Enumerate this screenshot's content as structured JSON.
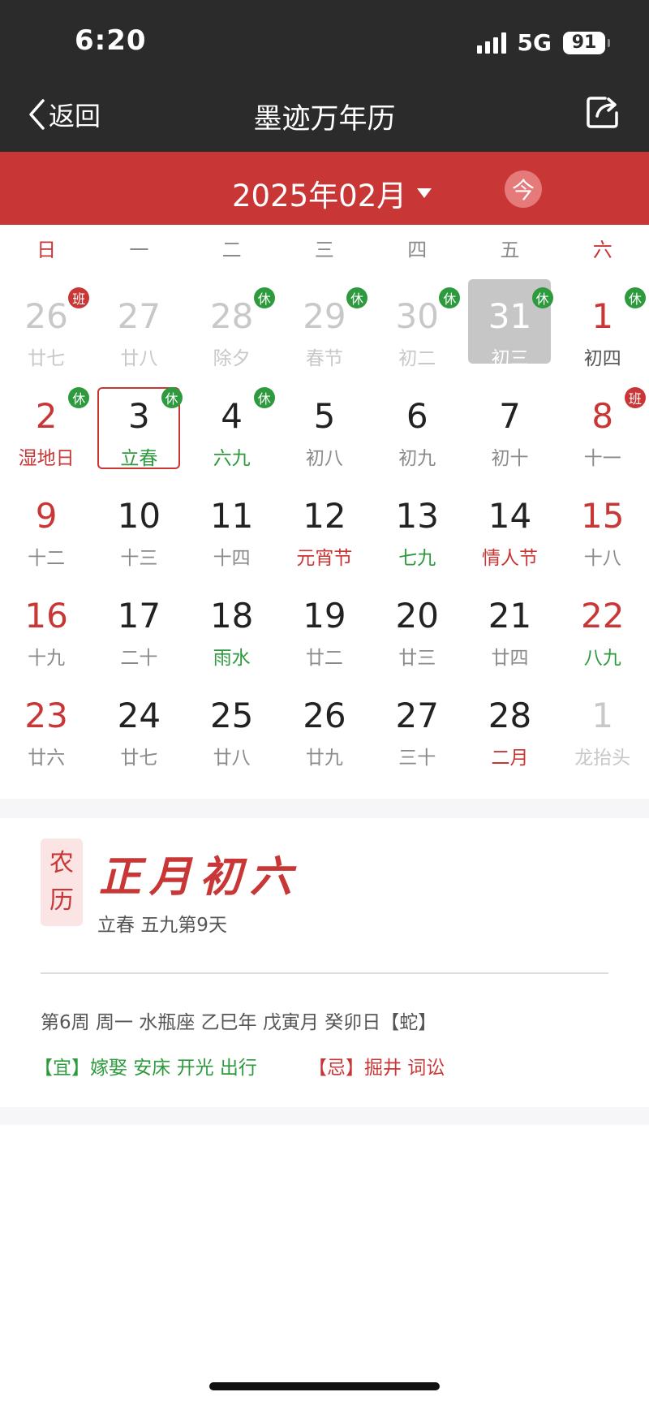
{
  "status": {
    "time": "6:20",
    "network": "5G",
    "battery": "91"
  },
  "nav": {
    "back_label": "返回",
    "title": "墨迹万年历"
  },
  "month_bar": {
    "month_label": "2025年02月",
    "today_label": "今"
  },
  "weekdays": [
    "日",
    "一",
    "二",
    "三",
    "四",
    "五",
    "六"
  ],
  "calendar": {
    "rows": [
      [
        {
          "day": "26",
          "sub": "廿七",
          "other": true,
          "badge": "班"
        },
        {
          "day": "27",
          "sub": "廿八",
          "other": true
        },
        {
          "day": "28",
          "sub": "除夕",
          "other": true,
          "badge": "休"
        },
        {
          "day": "29",
          "sub": "春节",
          "other": true,
          "badge": "休"
        },
        {
          "day": "30",
          "sub": "初二",
          "other": true,
          "badge": "休"
        },
        {
          "day": "31",
          "sub": "初三",
          "other": true,
          "badge": "休",
          "grey": true
        },
        {
          "day": "1",
          "sub": "初四",
          "red": true,
          "badge": "休",
          "subStyle": "dark"
        }
      ],
      [
        {
          "day": "2",
          "sub": "湿地日",
          "red": true,
          "badge": "休",
          "subStyle": "red"
        },
        {
          "day": "3",
          "sub": "立春",
          "badge": "休",
          "subStyle": "green",
          "selected": true
        },
        {
          "day": "4",
          "sub": "六九",
          "badge": "休",
          "subStyle": "green"
        },
        {
          "day": "5",
          "sub": "初八"
        },
        {
          "day": "6",
          "sub": "初九"
        },
        {
          "day": "7",
          "sub": "初十"
        },
        {
          "day": "8",
          "sub": "十一",
          "red": true,
          "badge": "班"
        }
      ],
      [
        {
          "day": "9",
          "sub": "十二",
          "red": true
        },
        {
          "day": "10",
          "sub": "十三"
        },
        {
          "day": "11",
          "sub": "十四"
        },
        {
          "day": "12",
          "sub": "元宵节",
          "subStyle": "red"
        },
        {
          "day": "13",
          "sub": "七九",
          "subStyle": "green"
        },
        {
          "day": "14",
          "sub": "情人节",
          "subStyle": "red"
        },
        {
          "day": "15",
          "sub": "十八",
          "red": true
        }
      ],
      [
        {
          "day": "16",
          "sub": "十九",
          "red": true
        },
        {
          "day": "17",
          "sub": "二十"
        },
        {
          "day": "18",
          "sub": "雨水",
          "subStyle": "green"
        },
        {
          "day": "19",
          "sub": "廿二"
        },
        {
          "day": "20",
          "sub": "廿三"
        },
        {
          "day": "21",
          "sub": "廿四"
        },
        {
          "day": "22",
          "sub": "八九",
          "red": true,
          "subStyle": "green"
        }
      ],
      [
        {
          "day": "23",
          "sub": "廿六",
          "red": true
        },
        {
          "day": "24",
          "sub": "廿七"
        },
        {
          "day": "25",
          "sub": "廿八"
        },
        {
          "day": "26",
          "sub": "廿九"
        },
        {
          "day": "27",
          "sub": "三十"
        },
        {
          "day": "28",
          "sub": "二月",
          "subStyle": "red"
        },
        {
          "day": "1",
          "sub": "龙抬头",
          "other": true
        }
      ]
    ]
  },
  "detail": {
    "tag_top": "农",
    "tag_bottom": "历",
    "lunar_date": "正月初六",
    "solar_term": "立春 五九第9天",
    "info_line": "第6周 周一 水瓶座 乙巳年 戊寅月 癸卯日【蛇】",
    "yi": "【宜】嫁娶 安床 开光 出行",
    "ji": "【忌】掘井 词讼"
  },
  "colors": {
    "header": "#2b2b2b",
    "accent": "#c93636",
    "rest_badge": "#2e9a3e"
  }
}
